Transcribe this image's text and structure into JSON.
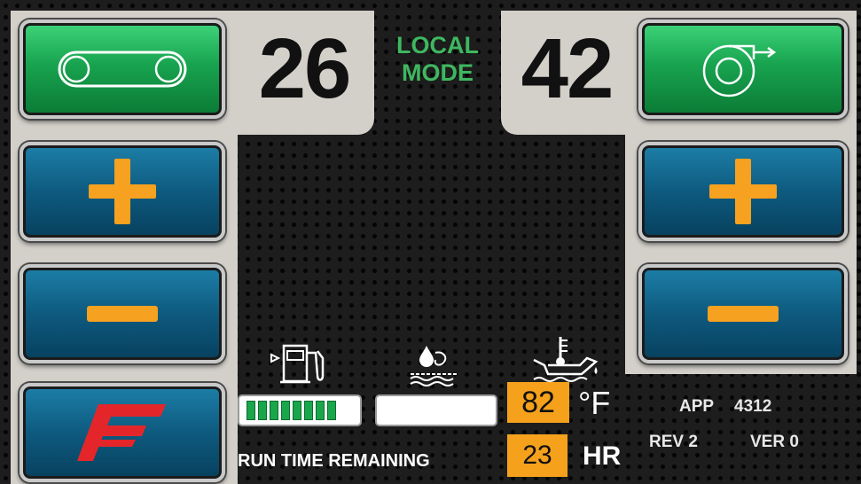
{
  "left_panel": {
    "setpoint": "26"
  },
  "right_panel": {
    "setpoint": "42"
  },
  "mode": {
    "line1": "LOCAL",
    "line2": "MODE"
  },
  "buttons": {
    "conveyor": "conveyor-belt-icon",
    "fan": "fan-blower-icon",
    "left_plus": "plus-icon",
    "left_minus": "minus-icon",
    "right_plus": "plus-icon",
    "right_minus": "minus-icon",
    "brand": "f-logo-icon"
  },
  "gauges": {
    "fuel_icon": "fuel-pump-icon",
    "water_icon": "water-drain-icon",
    "oil_temp_icon": "oil-temperature-icon",
    "fuel_level_fraction": 0.8,
    "fuel_segments": 8,
    "water_level_fraction": 0.0
  },
  "temperature": {
    "value": "82",
    "unit": "°F"
  },
  "runtime": {
    "label": "RUN TIME REMAINING",
    "value": "23",
    "unit": "HR"
  },
  "info": {
    "app_label": "APP",
    "app_value": "4312",
    "rev": "REV 2",
    "ver": "VER 0"
  },
  "colors": {
    "green": "#18a34f",
    "blue": "#0e5a7f",
    "orange": "#f5a11c",
    "mode_green": "#3fb760",
    "brand_red": "#e4262a"
  }
}
